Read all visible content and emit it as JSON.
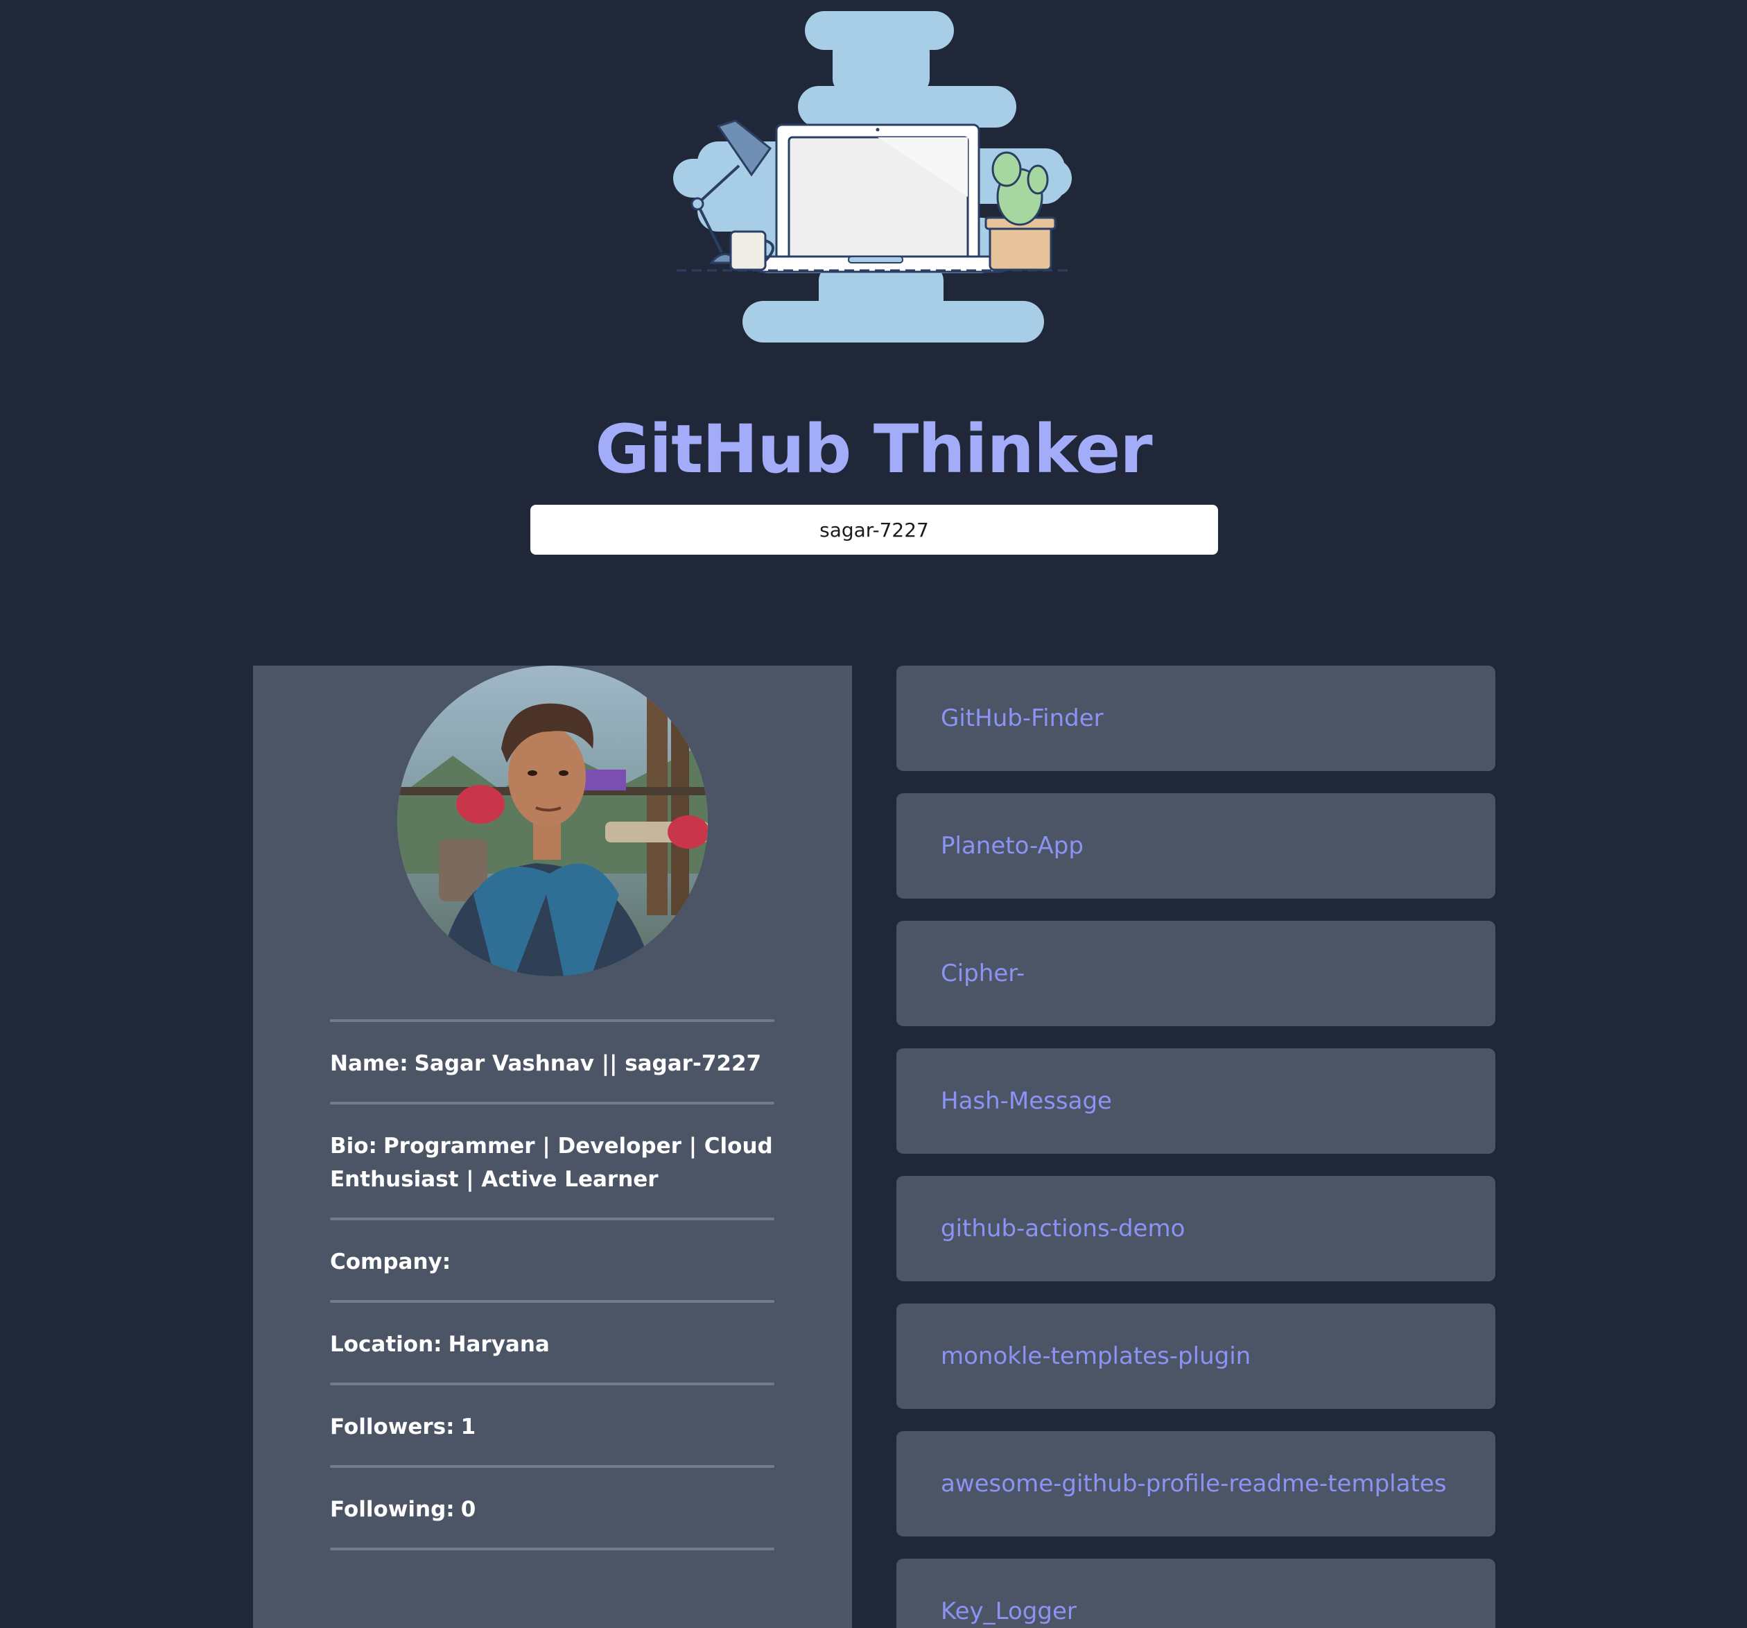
{
  "app": {
    "title": "GitHub Thinker",
    "title_color": "#a3acf8",
    "link_color": "#8b93f4"
  },
  "search": {
    "value": "sagar-7227"
  },
  "hero": {
    "icon": "desk-laptop-illustration"
  },
  "profile": {
    "avatar": "user-avatar",
    "fields": [
      {
        "label": "Name:",
        "value": "Sagar Vashnav || sagar-7227"
      },
      {
        "label": "Bio:",
        "value": "Programmer | Developer | Cloud Enthusiast | Active Learner"
      },
      {
        "label": "Company:",
        "value": ""
      },
      {
        "label": "Location:",
        "value": "Haryana"
      },
      {
        "label": "Followers:",
        "value": "1"
      },
      {
        "label": "Following:",
        "value": "0"
      }
    ]
  },
  "repos": [
    "GitHub-Finder",
    "Planeto-App",
    "Cipher-",
    "Hash-Message",
    "github-actions-demo",
    "monokle-templates-plugin",
    "awesome-github-profile-readme-templates",
    "Key_Logger"
  ]
}
